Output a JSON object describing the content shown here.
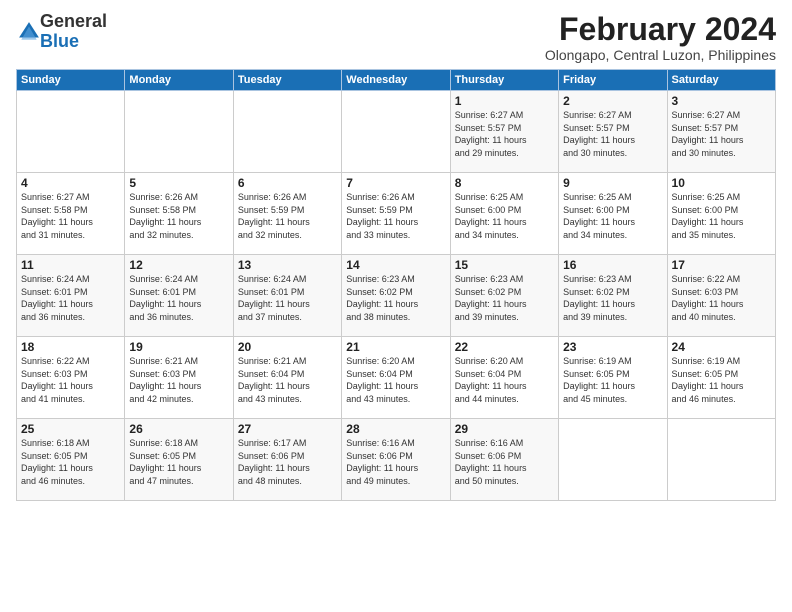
{
  "logo": {
    "general": "General",
    "blue": "Blue"
  },
  "title": "February 2024",
  "location": "Olongapo, Central Luzon, Philippines",
  "days_header": [
    "Sunday",
    "Monday",
    "Tuesday",
    "Wednesday",
    "Thursday",
    "Friday",
    "Saturday"
  ],
  "weeks": [
    [
      {
        "day": "",
        "info": ""
      },
      {
        "day": "",
        "info": ""
      },
      {
        "day": "",
        "info": ""
      },
      {
        "day": "",
        "info": ""
      },
      {
        "day": "1",
        "info": "Sunrise: 6:27 AM\nSunset: 5:57 PM\nDaylight: 11 hours\nand 29 minutes."
      },
      {
        "day": "2",
        "info": "Sunrise: 6:27 AM\nSunset: 5:57 PM\nDaylight: 11 hours\nand 30 minutes."
      },
      {
        "day": "3",
        "info": "Sunrise: 6:27 AM\nSunset: 5:57 PM\nDaylight: 11 hours\nand 30 minutes."
      }
    ],
    [
      {
        "day": "4",
        "info": "Sunrise: 6:27 AM\nSunset: 5:58 PM\nDaylight: 11 hours\nand 31 minutes."
      },
      {
        "day": "5",
        "info": "Sunrise: 6:26 AM\nSunset: 5:58 PM\nDaylight: 11 hours\nand 32 minutes."
      },
      {
        "day": "6",
        "info": "Sunrise: 6:26 AM\nSunset: 5:59 PM\nDaylight: 11 hours\nand 32 minutes."
      },
      {
        "day": "7",
        "info": "Sunrise: 6:26 AM\nSunset: 5:59 PM\nDaylight: 11 hours\nand 33 minutes."
      },
      {
        "day": "8",
        "info": "Sunrise: 6:25 AM\nSunset: 6:00 PM\nDaylight: 11 hours\nand 34 minutes."
      },
      {
        "day": "9",
        "info": "Sunrise: 6:25 AM\nSunset: 6:00 PM\nDaylight: 11 hours\nand 34 minutes."
      },
      {
        "day": "10",
        "info": "Sunrise: 6:25 AM\nSunset: 6:00 PM\nDaylight: 11 hours\nand 35 minutes."
      }
    ],
    [
      {
        "day": "11",
        "info": "Sunrise: 6:24 AM\nSunset: 6:01 PM\nDaylight: 11 hours\nand 36 minutes."
      },
      {
        "day": "12",
        "info": "Sunrise: 6:24 AM\nSunset: 6:01 PM\nDaylight: 11 hours\nand 36 minutes."
      },
      {
        "day": "13",
        "info": "Sunrise: 6:24 AM\nSunset: 6:01 PM\nDaylight: 11 hours\nand 37 minutes."
      },
      {
        "day": "14",
        "info": "Sunrise: 6:23 AM\nSunset: 6:02 PM\nDaylight: 11 hours\nand 38 minutes."
      },
      {
        "day": "15",
        "info": "Sunrise: 6:23 AM\nSunset: 6:02 PM\nDaylight: 11 hours\nand 39 minutes."
      },
      {
        "day": "16",
        "info": "Sunrise: 6:23 AM\nSunset: 6:02 PM\nDaylight: 11 hours\nand 39 minutes."
      },
      {
        "day": "17",
        "info": "Sunrise: 6:22 AM\nSunset: 6:03 PM\nDaylight: 11 hours\nand 40 minutes."
      }
    ],
    [
      {
        "day": "18",
        "info": "Sunrise: 6:22 AM\nSunset: 6:03 PM\nDaylight: 11 hours\nand 41 minutes."
      },
      {
        "day": "19",
        "info": "Sunrise: 6:21 AM\nSunset: 6:03 PM\nDaylight: 11 hours\nand 42 minutes."
      },
      {
        "day": "20",
        "info": "Sunrise: 6:21 AM\nSunset: 6:04 PM\nDaylight: 11 hours\nand 43 minutes."
      },
      {
        "day": "21",
        "info": "Sunrise: 6:20 AM\nSunset: 6:04 PM\nDaylight: 11 hours\nand 43 minutes."
      },
      {
        "day": "22",
        "info": "Sunrise: 6:20 AM\nSunset: 6:04 PM\nDaylight: 11 hours\nand 44 minutes."
      },
      {
        "day": "23",
        "info": "Sunrise: 6:19 AM\nSunset: 6:05 PM\nDaylight: 11 hours\nand 45 minutes."
      },
      {
        "day": "24",
        "info": "Sunrise: 6:19 AM\nSunset: 6:05 PM\nDaylight: 11 hours\nand 46 minutes."
      }
    ],
    [
      {
        "day": "25",
        "info": "Sunrise: 6:18 AM\nSunset: 6:05 PM\nDaylight: 11 hours\nand 46 minutes."
      },
      {
        "day": "26",
        "info": "Sunrise: 6:18 AM\nSunset: 6:05 PM\nDaylight: 11 hours\nand 47 minutes."
      },
      {
        "day": "27",
        "info": "Sunrise: 6:17 AM\nSunset: 6:06 PM\nDaylight: 11 hours\nand 48 minutes."
      },
      {
        "day": "28",
        "info": "Sunrise: 6:16 AM\nSunset: 6:06 PM\nDaylight: 11 hours\nand 49 minutes."
      },
      {
        "day": "29",
        "info": "Sunrise: 6:16 AM\nSunset: 6:06 PM\nDaylight: 11 hours\nand 50 minutes."
      },
      {
        "day": "",
        "info": ""
      },
      {
        "day": "",
        "info": ""
      }
    ]
  ]
}
